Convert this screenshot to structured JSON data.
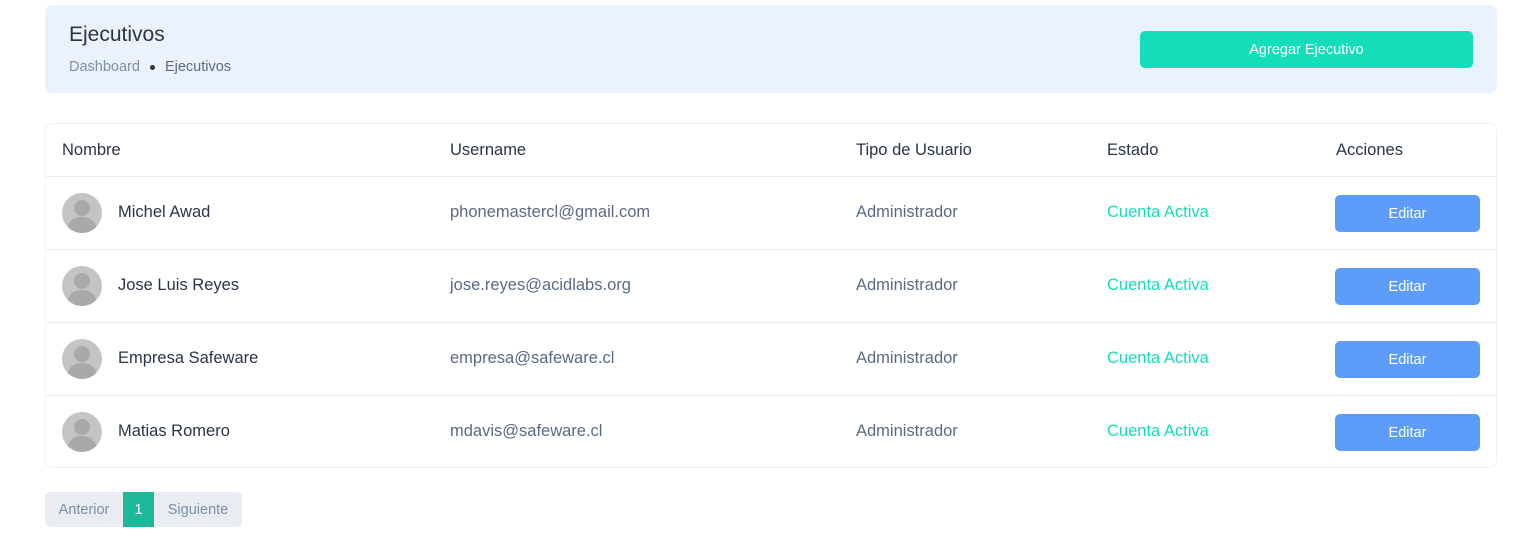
{
  "header": {
    "title": "Ejecutivos",
    "breadcrumb": {
      "root": "Dashboard",
      "current": "Ejecutivos"
    },
    "add_button_label": "Agregar Ejecutivo"
  },
  "table": {
    "columns": [
      "Nombre",
      "Username",
      "Tipo de Usuario",
      "Estado",
      "Acciones"
    ],
    "rows": [
      {
        "name": "Michel Awad",
        "username": "phonemastercl@gmail.com",
        "user_type": "Administrador",
        "status": "Cuenta Activa",
        "action_label": "Editar"
      },
      {
        "name": "Jose Luis Reyes",
        "username": "jose.reyes@acidlabs.org",
        "user_type": "Administrador",
        "status": "Cuenta Activa",
        "action_label": "Editar"
      },
      {
        "name": "Empresa Safeware",
        "username": "empresa@safeware.cl",
        "user_type": "Administrador",
        "status": "Cuenta Activa",
        "action_label": "Editar"
      },
      {
        "name": "Matias Romero",
        "username": "mdavis@safeware.cl",
        "user_type": "Administrador",
        "status": "Cuenta Activa",
        "action_label": "Editar"
      }
    ]
  },
  "pagination": {
    "previous_label": "Anterior",
    "current_page": "1",
    "next_label": "Siguiente"
  },
  "colors": {
    "header_background": "#eaf2fd",
    "primary_action": "#13deb9",
    "edit_action": "#5d9cf8",
    "status_active": "#13deb9",
    "pagination_active": "#1cb89a"
  },
  "icons": {
    "avatar": "user-placeholder-icon"
  }
}
